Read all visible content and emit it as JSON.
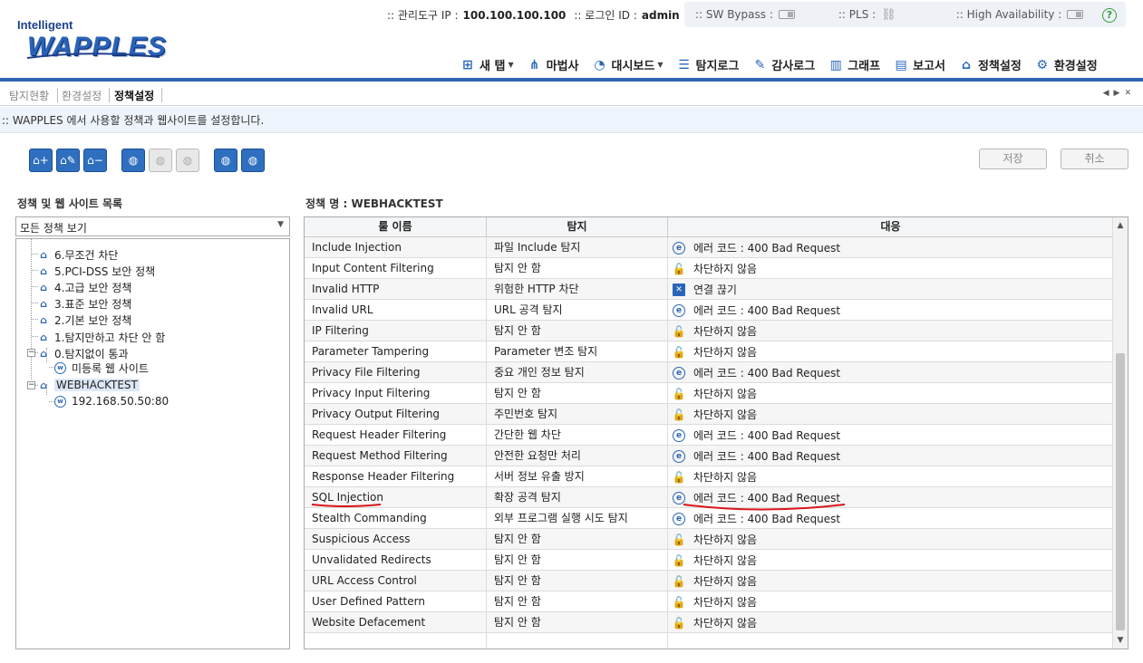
{
  "brand": {
    "small": "Intelligent",
    "big": "WAPPLES"
  },
  "admin_info": {
    "ip_label": ":: 관리도구 IP :",
    "ip_value": "100.100.100.100",
    "login_label": ":: 로그인 ID :",
    "login_value": "admin"
  },
  "status": {
    "sw_bypass": ":: SW Bypass :",
    "pls": ":: PLS :",
    "ha": ":: High Availability :",
    "help_icon": "help-icon"
  },
  "menu": [
    {
      "label": "새 탭",
      "icon": "new-tab-icon",
      "glyph": "⊞",
      "caret": true
    },
    {
      "label": "마법사",
      "icon": "wizard-icon",
      "glyph": "⋔",
      "caret": false
    },
    {
      "label": "대시보드",
      "icon": "dashboard-icon",
      "glyph": "◔",
      "caret": true
    },
    {
      "label": "탐지로그",
      "icon": "detect-log-icon",
      "glyph": "☰",
      "caret": false
    },
    {
      "label": "감사로그",
      "icon": "audit-log-icon",
      "glyph": "✎",
      "caret": false
    },
    {
      "label": "그래프",
      "icon": "graph-icon",
      "glyph": "▥",
      "caret": false
    },
    {
      "label": "보고서",
      "icon": "report-icon",
      "glyph": "▤",
      "caret": false
    },
    {
      "label": "정책설정",
      "icon": "policy-icon",
      "glyph": "⌂",
      "caret": false
    },
    {
      "label": "환경설정",
      "icon": "settings-icon",
      "glyph": "⚙",
      "caret": false
    }
  ],
  "tabs": [
    {
      "label": "탐지현황",
      "active": false
    },
    {
      "label": "환경설정",
      "active": false
    },
    {
      "label": "정책설정",
      "active": true
    }
  ],
  "description": ":: WAPPLES 에서 사용할 정책과 웹사이트를 설정합니다.",
  "buttons": {
    "save": "저장",
    "cancel": "취소"
  },
  "left_panel": {
    "title": "정책 및 웹 사이트 목록",
    "select_value": "모든 정책 보기",
    "tree": [
      {
        "label": "6.무조건 차단",
        "type": "policy"
      },
      {
        "label": "5.PCI-DSS 보안 정책",
        "type": "policy"
      },
      {
        "label": "4.고급 보안 정책",
        "type": "policy"
      },
      {
        "label": "3.표준 보안 정책",
        "type": "policy"
      },
      {
        "label": "2.기본 보안 정책",
        "type": "policy"
      },
      {
        "label": "1.탐지만하고 차단 안 함",
        "type": "policy"
      },
      {
        "label": "0.탐지없이 통과",
        "type": "policy"
      },
      {
        "label": "미등록 웹 사이트",
        "type": "site"
      },
      {
        "label": "WEBHACKTEST",
        "type": "policy"
      },
      {
        "label": "192.168.50.50:80",
        "type": "site"
      }
    ]
  },
  "right_panel": {
    "title": "정책 명 : WEBHACKTEST",
    "columns": [
      "룰 이름",
      "탐지",
      "대응"
    ],
    "rows": [
      {
        "rule": "Include Injection",
        "detect": "파일 Include 탐지",
        "response": "에러 코드 : 400 Bad Request",
        "icon": "error-page-icon"
      },
      {
        "rule": "Input Content Filtering",
        "detect": "탐지 안 함",
        "response": "차단하지 않음",
        "icon": "unlock-icon"
      },
      {
        "rule": "Invalid HTTP",
        "detect": "위험한 HTTP 차단",
        "response": "연결 끊기",
        "icon": "disconnect-icon"
      },
      {
        "rule": "Invalid URL",
        "detect": "URL 공격 탐지",
        "response": "에러 코드 : 400 Bad Request",
        "icon": "error-page-icon"
      },
      {
        "rule": "IP Filtering",
        "detect": "탐지 안 함",
        "response": "차단하지 않음",
        "icon": "unlock-icon"
      },
      {
        "rule": "Parameter Tampering",
        "detect": "Parameter 변조 탐지",
        "response": "차단하지 않음",
        "icon": "unlock-icon"
      },
      {
        "rule": "Privacy File Filtering",
        "detect": "중요 개인 정보 탐지",
        "response": "에러 코드 : 400 Bad Request",
        "icon": "error-page-icon"
      },
      {
        "rule": "Privacy Input Filtering",
        "detect": "탐지 안 함",
        "response": "차단하지 않음",
        "icon": "unlock-icon"
      },
      {
        "rule": "Privacy Output Filtering",
        "detect": "주민번호 탐지",
        "response": "차단하지 않음",
        "icon": "unlock-icon"
      },
      {
        "rule": "Request Header Filtering",
        "detect": "간단한 웹 차단",
        "response": "에러 코드 : 400 Bad Request",
        "icon": "error-page-icon"
      },
      {
        "rule": "Request Method Filtering",
        "detect": "안전한 요청만 처리",
        "response": "에러 코드 : 400 Bad Request",
        "icon": "error-page-icon"
      },
      {
        "rule": "Response Header Filtering",
        "detect": "서버 정보 유출 방지",
        "response": "차단하지 않음",
        "icon": "unlock-icon"
      },
      {
        "rule": "SQL Injection",
        "detect": "확장 공격 탐지",
        "response": "에러 코드 : 400 Bad Request",
        "icon": "error-page-icon"
      },
      {
        "rule": "Stealth Commanding",
        "detect": "외부 프로그램 실행 시도 탐지",
        "response": "에러 코드 : 400 Bad Request",
        "icon": "error-page-icon"
      },
      {
        "rule": "Suspicious Access",
        "detect": "탐지 안 함",
        "response": "차단하지 않음",
        "icon": "unlock-icon"
      },
      {
        "rule": "Unvalidated Redirects",
        "detect": "탐지 안 함",
        "response": "차단하지 않음",
        "icon": "unlock-icon"
      },
      {
        "rule": "URL Access Control",
        "detect": "탐지 안 함",
        "response": "차단하지 않음",
        "icon": "unlock-icon"
      },
      {
        "rule": "User Defined Pattern",
        "detect": "탐지 안 함",
        "response": "차단하지 않음",
        "icon": "unlock-icon"
      },
      {
        "rule": "Website Defacement",
        "detect": "탐지 안 함",
        "response": "차단하지 않음",
        "icon": "unlock-icon"
      }
    ]
  },
  "colors": {
    "accent": "#2f62b0",
    "annotation": "#d9141b"
  }
}
